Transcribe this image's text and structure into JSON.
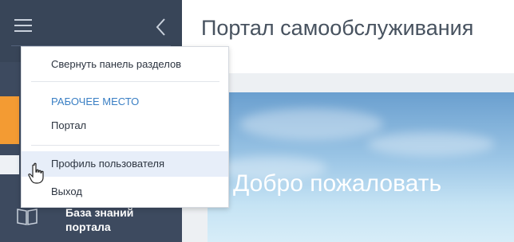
{
  "sidebar": {
    "item_label": "База знаний портала",
    "colors": {
      "background": "#3d4a5f",
      "accent": "#f39b33"
    },
    "icons": [
      "hamburger-icon",
      "chevron-left-icon",
      "book-icon"
    ]
  },
  "main": {
    "title": "Портал самообслуживания",
    "banner_text": "Добро пожаловать"
  },
  "dropdown": {
    "collapse_label": "Свернуть панель разделов",
    "section_header": "РАБОЧЕЕ МЕСТО",
    "portal_label": "Портал",
    "profile_label": "Профиль пользователя",
    "exit_label": "Выход",
    "hovered_item": "Профиль пользователя",
    "colors": {
      "header": "#3a7fc4",
      "hover": "#e7eef9"
    }
  }
}
